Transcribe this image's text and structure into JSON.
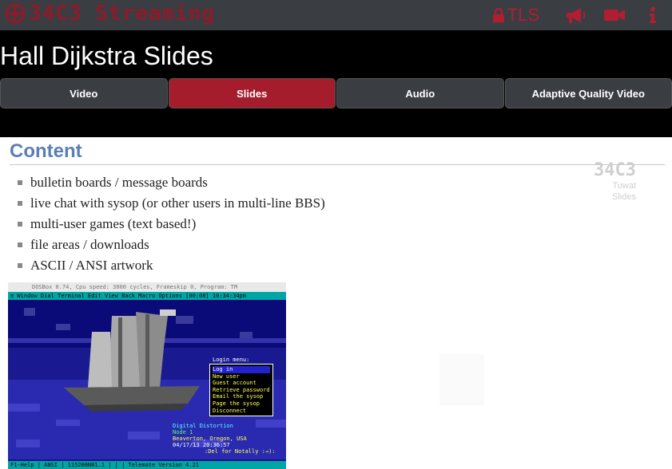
{
  "header": {
    "brand": "34C3 Streaming",
    "tls_label": "TLS",
    "icons": [
      "lock-icon",
      "megaphone-icon",
      "video-camera-icon",
      "info-icon"
    ],
    "accent_color": "#b11e32"
  },
  "page": {
    "title": "Hall Dijkstra Slides"
  },
  "tabs": [
    {
      "label": "Video",
      "active": false
    },
    {
      "label": "Slides",
      "active": true
    },
    {
      "label": "Audio",
      "active": false
    },
    {
      "label": "Adaptive Quality Video",
      "active": false
    }
  ],
  "slide": {
    "title": "Content",
    "bullets": [
      "bulletin boards / message boards",
      "live chat with sysop (or other users in multi-line BBS)",
      "multi-user games (text based!)",
      "file areas / downloads",
      "ASCII / ANSI artwork"
    ],
    "watermark": {
      "logo": "34C3",
      "line1": "Tuwat",
      "line2": "Slides"
    },
    "terminal": {
      "titlebar": "DOSBox 0.74, Cpu speed:    3000 cycles, Frameskip 0, Program:    TM",
      "menubar": "≡  Window  Dial  Terminal  Edit  View  Back  Macro  Options  [00:08] 10:34:34pm",
      "login_title": "Login menu:",
      "login_items": [
        "Log in",
        "New user",
        "Guest account",
        "Retrieve password",
        "Email the sysop",
        "Page the sysop",
        "Disconnect"
      ],
      "info": {
        "name": "Digital Distortion",
        "node": "Node 1",
        "place": "Beaverton, Oregon, USA",
        "date": "04/17/13 20:36:57"
      },
      "prompt": ":Del for Notally :→):",
      "status": "F1-Help | ANSI | 115200N81.1 |       |       | Telemate Version 4.21"
    }
  }
}
